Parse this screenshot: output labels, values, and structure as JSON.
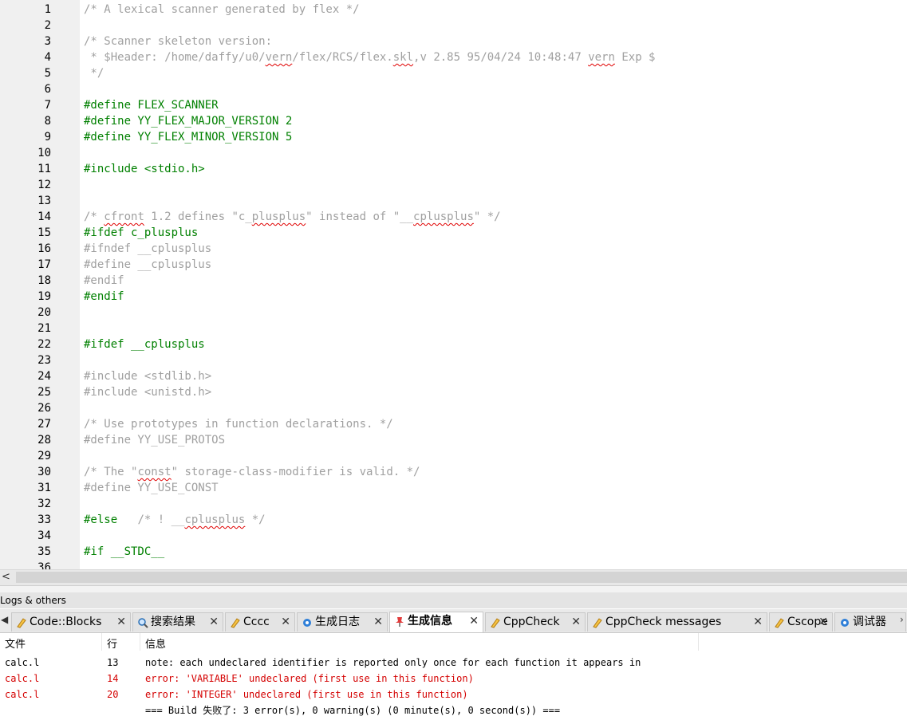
{
  "editor": {
    "lines": [
      {
        "n": "1",
        "segs": [
          {
            "t": "/* A lexical scanner generated by flex */",
            "c": "c-comment"
          }
        ]
      },
      {
        "n": "2",
        "segs": []
      },
      {
        "n": "3",
        "segs": [
          {
            "t": "/* Scanner skeleton version:",
            "c": "c-comment"
          }
        ]
      },
      {
        "n": "4",
        "segs": [
          {
            "t": " * $Header: /home/daffy/u0/",
            "c": "c-comment"
          },
          {
            "t": "vern",
            "c": "c-comment sq"
          },
          {
            "t": "/flex/RCS/flex.",
            "c": "c-comment"
          },
          {
            "t": "skl",
            "c": "c-comment sq"
          },
          {
            "t": ",v 2.85 95/04/24 10:48:47 ",
            "c": "c-comment"
          },
          {
            "t": "vern",
            "c": "c-comment sq"
          },
          {
            "t": " Exp $",
            "c": "c-comment"
          }
        ]
      },
      {
        "n": "5",
        "segs": [
          {
            "t": " */",
            "c": "c-comment"
          }
        ]
      },
      {
        "n": "6",
        "segs": []
      },
      {
        "n": "7",
        "segs": [
          {
            "t": "#define FLEX_SCANNER",
            "c": "c-pp"
          }
        ]
      },
      {
        "n": "8",
        "segs": [
          {
            "t": "#define YY_FLEX_MAJOR_VERSION 2",
            "c": "c-pp"
          }
        ]
      },
      {
        "n": "9",
        "segs": [
          {
            "t": "#define YY_FLEX_MINOR_VERSION 5",
            "c": "c-pp"
          }
        ]
      },
      {
        "n": "10",
        "segs": []
      },
      {
        "n": "11",
        "segs": [
          {
            "t": "#include <stdio.h>",
            "c": "c-pp"
          }
        ]
      },
      {
        "n": "12",
        "segs": []
      },
      {
        "n": "13",
        "segs": []
      },
      {
        "n": "14",
        "segs": [
          {
            "t": "/* ",
            "c": "c-comment"
          },
          {
            "t": "cfront",
            "c": "c-comment sq"
          },
          {
            "t": " 1.2 defines \"c_",
            "c": "c-comment"
          },
          {
            "t": "plusplus",
            "c": "c-comment sq"
          },
          {
            "t": "\" instead of \"__",
            "c": "c-comment"
          },
          {
            "t": "cplusplus",
            "c": "c-comment sq"
          },
          {
            "t": "\" */",
            "c": "c-comment"
          }
        ]
      },
      {
        "n": "15",
        "segs": [
          {
            "t": "#ifdef c_plusplus",
            "c": "c-pp"
          }
        ]
      },
      {
        "n": "16",
        "segs": [
          {
            "t": "#ifndef __cplusplus",
            "c": "c-ppi"
          }
        ]
      },
      {
        "n": "17",
        "segs": [
          {
            "t": "#define __cplusplus",
            "c": "c-ppi"
          }
        ]
      },
      {
        "n": "18",
        "segs": [
          {
            "t": "#endif",
            "c": "c-ppi"
          }
        ]
      },
      {
        "n": "19",
        "segs": [
          {
            "t": "#endif",
            "c": "c-pp"
          }
        ]
      },
      {
        "n": "20",
        "segs": []
      },
      {
        "n": "21",
        "segs": []
      },
      {
        "n": "22",
        "segs": [
          {
            "t": "#ifdef __cplusplus",
            "c": "c-pp"
          }
        ]
      },
      {
        "n": "23",
        "segs": []
      },
      {
        "n": "24",
        "segs": [
          {
            "t": "#include <stdlib.h>",
            "c": "c-ppi"
          }
        ]
      },
      {
        "n": "25",
        "segs": [
          {
            "t": "#include <unistd.h>",
            "c": "c-ppi"
          }
        ]
      },
      {
        "n": "26",
        "segs": []
      },
      {
        "n": "27",
        "segs": [
          {
            "t": "/* Use prototypes in function declarations. */",
            "c": "c-comment"
          }
        ]
      },
      {
        "n": "28",
        "segs": [
          {
            "t": "#define YY_USE_PROTOS",
            "c": "c-ppi"
          }
        ]
      },
      {
        "n": "29",
        "segs": []
      },
      {
        "n": "30",
        "segs": [
          {
            "t": "/* The \"",
            "c": "c-comment"
          },
          {
            "t": "const",
            "c": "c-comment sq"
          },
          {
            "t": "\" storage-class-modifier is valid. */",
            "c": "c-comment"
          }
        ]
      },
      {
        "n": "31",
        "segs": [
          {
            "t": "#define YY_USE_CONST",
            "c": "c-ppi"
          }
        ]
      },
      {
        "n": "32",
        "segs": []
      },
      {
        "n": "33",
        "segs": [
          {
            "t": "#else",
            "c": "c-pp"
          },
          {
            "t": "   /* ! __",
            "c": "c-comment"
          },
          {
            "t": "cplusplus",
            "c": "c-comment sq"
          },
          {
            "t": " */",
            "c": "c-comment"
          }
        ]
      },
      {
        "n": "34",
        "segs": []
      },
      {
        "n": "35",
        "segs": [
          {
            "t": "#if __STDC__",
            "c": "c-pp"
          }
        ]
      },
      {
        "n": "36",
        "segs": []
      }
    ]
  },
  "scrollbar": {
    "left_arrow": "<"
  },
  "logs": {
    "title": "Logs & others",
    "tab_left_arrow": "◀",
    "tab_right_arrow": "›",
    "tabs": [
      {
        "label": "Code::Blocks",
        "icon": "codeblocks-icon",
        "close": "✕"
      },
      {
        "label": "搜索结果",
        "icon": "search-icon",
        "close": "✕"
      },
      {
        "label": "Cccc",
        "icon": "pencil-icon",
        "close": "✕"
      },
      {
        "label": "生成日志",
        "icon": "gear-icon",
        "close": "✕"
      },
      {
        "label": "生成信息",
        "icon": "pin-icon",
        "close": "✕",
        "active": true
      },
      {
        "label": "CppCheck",
        "icon": "pencil-icon",
        "close": "✕"
      },
      {
        "label": "CppCheck messages",
        "icon": "pencil-icon",
        "close": "✕"
      },
      {
        "label": "Cscope",
        "icon": "pencil-icon",
        "close": "✕"
      },
      {
        "label": "调试器",
        "icon": "gear-icon",
        "close": ""
      }
    ],
    "columns": [
      "文件",
      "行",
      "信息"
    ],
    "rows": [
      {
        "file": "calc.l",
        "line": "13",
        "msg": "note: each undeclared identifier is reported only once for each function it appears in",
        "type": "note"
      },
      {
        "file": "calc.l",
        "line": "14",
        "msg": "error: 'VARIABLE' undeclared (first use in this function)",
        "type": "error"
      },
      {
        "file": "calc.l",
        "line": "20",
        "msg": "error: 'INTEGER' undeclared (first use in this function)",
        "type": "error"
      },
      {
        "file": "",
        "line": "",
        "msg": "=== Build 失败了: 3 error(s), 0 warning(s) (0 minute(s), 0 second(s)) ===",
        "type": "summary"
      }
    ]
  }
}
